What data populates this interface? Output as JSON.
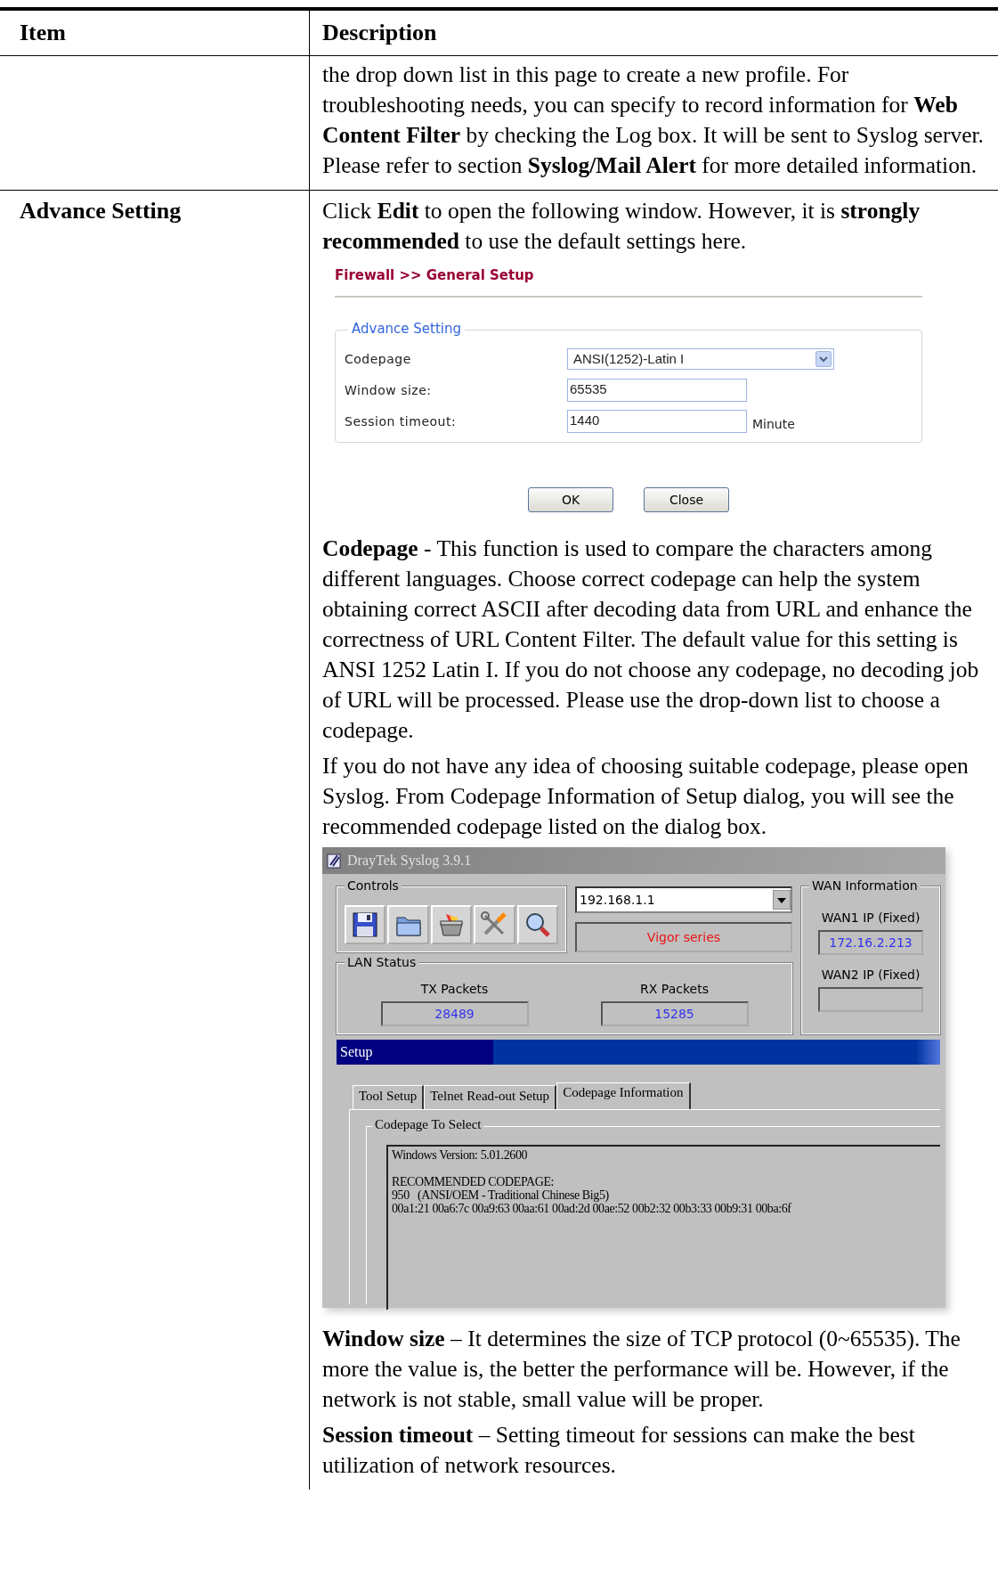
{
  "table": {
    "columns": [
      "Item",
      "Description"
    ],
    "rows": [
      {
        "description": [
          {
            "kind": "text",
            "text": "the drop down list in this page to create a new profile. For troubleshooting needs, you can specify to record information for **Web Content Filter** by checking the Log box. It will be sent to Syslog server. Please refer to section **Syslog/Mail Alert** for more detailed information."
          }
        ]
      },
      {
        "item": "Advance Setting",
        "description": [
          {
            "kind": "text",
            "text": "Click **Edit** to open the following window. However, it is **strongly recommended** to use the default settings here."
          },
          {
            "kind": "dialog",
            "title": "Firewall >> General Setup",
            "group": "Advance Setting",
            "fields": [
              {
                "label": "Codepage",
                "kind": "select",
                "value": "ANSI(1252)-Latin I"
              },
              {
                "label": "Window size:",
                "kind": "input",
                "value": "65535"
              },
              {
                "label": "Session timeout:",
                "kind": "input",
                "value": "1440",
                "unit": "Minute"
              }
            ],
            "buttons": [
              "OK",
              "Close"
            ]
          },
          {
            "kind": "text",
            "text": "**Codepage** - This function is used to compare the characters among different languages. Choose correct codepage can help the system obtaining correct ASCII after decoding data from URL and enhance the correctness of URL Content Filter. The default value for this setting is ANSI 1252 Latin I. If you do not choose any codepage, no decoding job of URL will be processed. Please use the drop-down list to choose a codepage."
          },
          {
            "kind": "text",
            "text": "If you do not have any idea of choosing suitable codepage, please open Syslog. From Codepage Information of Setup dialog, you will see the recommended codepage listed on the dialog box."
          },
          {
            "kind": "syslog_window",
            "title": "DrayTek Syslog 3.9.1",
            "controls_title": "Controls",
            "router_ip": "192.168.1.1",
            "model": "Vigor series",
            "lan": {
              "title": "LAN Status",
              "tx_label": "TX Packets",
              "tx": "28489",
              "rx_label": "RX Packets",
              "rx": "15285"
            },
            "wan": {
              "title": "WAN Information",
              "items": [
                {
                  "label": "WAN1 IP (Fixed)",
                  "value": "172.16.2.213"
                },
                {
                  "label": "WAN2 IP (Fixed)"
                }
              ]
            },
            "panel_title": "Setup",
            "tabs": [
              {
                "label": "Tool Setup",
                "selected": false
              },
              {
                "label": "Telnet Read-out Setup",
                "selected": false
              },
              {
                "label": "Codepage Information",
                "selected": true
              }
            ],
            "group": "Codepage To Select",
            "blocks": [
              [
                "Windows Version: 5.01.2600"
              ],
              [
                "RECOMMENDED CODEPAGE:",
                "950   (ANSI/OEM - Traditional Chinese Big5)",
                "00a1:21 00a6:7c 00a9:63 00aa:61 00ad:2d 00ae:52 00b2:32 00b3:33 00b9:31 00ba:6f"
              ]
            ]
          },
          {
            "kind": "text",
            "text": "**Window size** – It determines the size of TCP protocol (0~65535). The more the value is, the better the performance will be. However, if the network is not stable, small value will be proper."
          },
          {
            "kind": "text",
            "text": "**Session timeout** – Setting timeout for sessions can make the best utilization of network resources."
          }
        ]
      }
    ]
  }
}
